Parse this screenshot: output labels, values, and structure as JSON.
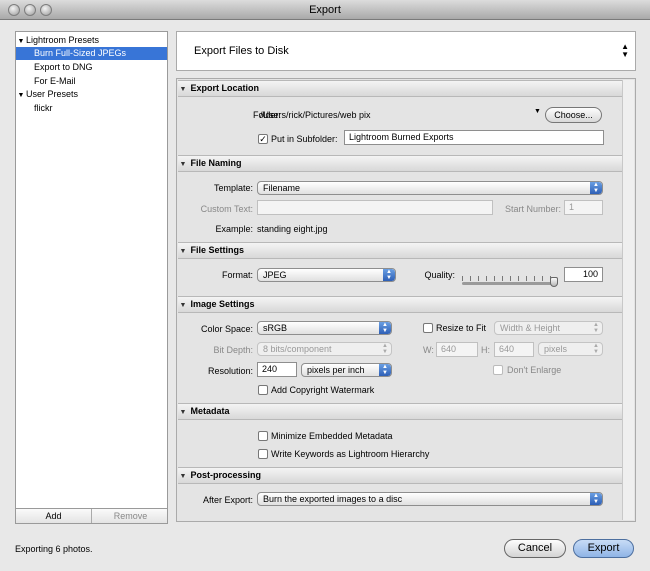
{
  "window": {
    "title": "Export"
  },
  "sidebar": {
    "groups": [
      {
        "label": "Lightroom Presets",
        "items": [
          "Burn Full-Sized JPEGs",
          "Export to DNG",
          "For E-Mail"
        ]
      },
      {
        "label": "User Presets",
        "items": [
          "flickr"
        ]
      }
    ],
    "selected": "Burn Full-Sized JPEGs",
    "add_label": "Add",
    "remove_label": "Remove"
  },
  "destination": {
    "label": "Export Files to Disk"
  },
  "sections": {
    "export_location": {
      "title": "Export Location",
      "folder_label": "Folder:",
      "folder_value": "/Users/rick/Pictures/web pix",
      "choose_label": "Choose...",
      "subfolder_label": "Put in Subfolder:",
      "subfolder_checked": true,
      "subfolder_value": "Lightroom Burned Exports"
    },
    "file_naming": {
      "title": "File Naming",
      "template_label": "Template:",
      "template_value": "Filename",
      "custom_text_label": "Custom Text:",
      "custom_text_value": "",
      "start_number_label": "Start Number:",
      "start_number_value": "1",
      "example_label": "Example:",
      "example_value": "standing eight.jpg"
    },
    "file_settings": {
      "title": "File Settings",
      "format_label": "Format:",
      "format_value": "JPEG",
      "quality_label": "Quality:",
      "quality_value": "100",
      "quality_fraction": 1.0
    },
    "image_settings": {
      "title": "Image Settings",
      "color_space_label": "Color Space:",
      "color_space_value": "sRGB",
      "bit_depth_label": "Bit Depth:",
      "bit_depth_value": "8 bits/component",
      "resolution_label": "Resolution:",
      "resolution_value": "240",
      "resolution_unit": "pixels per inch",
      "watermark_label": "Add Copyright Watermark",
      "watermark_checked": false,
      "resize_label": "Resize to Fit",
      "resize_checked": false,
      "resize_mode": "Width & Height",
      "w_label": "W:",
      "w_value": "640",
      "h_label": "H:",
      "h_value": "640",
      "size_unit": "pixels",
      "dont_enlarge_label": "Don't Enlarge"
    },
    "metadata": {
      "title": "Metadata",
      "minimize_label": "Minimize Embedded Metadata",
      "keywords_label": "Write Keywords as Lightroom Hierarchy"
    },
    "post_processing": {
      "title": "Post-processing",
      "after_export_label": "After Export:",
      "after_export_value": "Burn the exported images to a disc"
    }
  },
  "footer": {
    "status": "Exporting 6 photos.",
    "cancel_label": "Cancel",
    "export_label": "Export"
  },
  "icons": {
    "expand": "triangle-down-icon",
    "popup": "updown-arrows-icon",
    "check": "checkmark-icon"
  },
  "colors": {
    "selection": "#3875d7",
    "accent_button": "#8fb4e6"
  }
}
